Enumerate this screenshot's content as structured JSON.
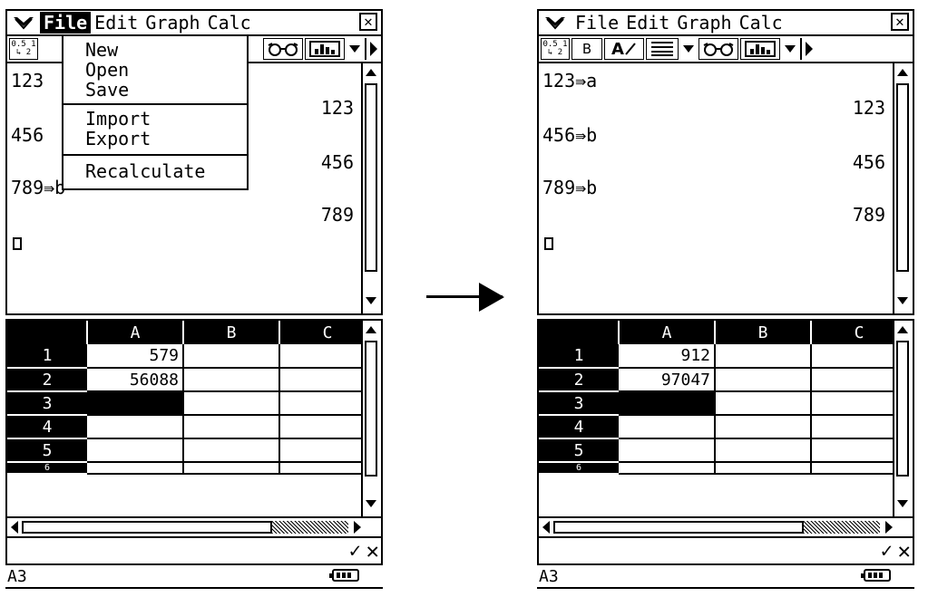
{
  "left": {
    "menu": [
      "File",
      "Edit",
      "Graph",
      "Calc"
    ],
    "active_menu": "File",
    "close_label": "✕",
    "toolbar": {
      "frac_top": "0.5 1",
      "frac_bot": "↳ 2"
    },
    "dropdown": [
      "New",
      "Open",
      "Save",
      "Import",
      "Export",
      "Recalculate"
    ],
    "main": {
      "partial_inputs": [
        "123",
        "456",
        "789⇛b"
      ],
      "outputs": [
        "123",
        "456",
        "789"
      ]
    },
    "sheet": {
      "columns": [
        "A",
        "B",
        "C"
      ],
      "rows": [
        {
          "num": "1",
          "a": "579"
        },
        {
          "num": "2",
          "a": "56088"
        },
        {
          "num": "3",
          "a": ""
        },
        {
          "num": "4",
          "a": ""
        },
        {
          "num": "5",
          "a": ""
        },
        {
          "num": "6",
          "a": ""
        }
      ]
    },
    "cell_ref": "A3"
  },
  "right": {
    "menu": [
      "File",
      "Edit",
      "Graph",
      "Calc"
    ],
    "close_label": "✕",
    "toolbar": {
      "frac_top": "0.5 1",
      "frac_bot": "↳ 2",
      "b_label": "B",
      "a_label": "A"
    },
    "main": {
      "inputs": [
        "123⇛a",
        "456⇛b",
        "789⇛b"
      ],
      "outputs": [
        "123",
        "456",
        "789"
      ]
    },
    "sheet": {
      "columns": [
        "A",
        "B",
        "C"
      ],
      "rows": [
        {
          "num": "1",
          "a": "912"
        },
        {
          "num": "2",
          "a": "97047"
        },
        {
          "num": "3",
          "a": ""
        },
        {
          "num": "4",
          "a": ""
        },
        {
          "num": "5",
          "a": ""
        },
        {
          "num": "6",
          "a": ""
        }
      ]
    },
    "cell_ref": "A3"
  },
  "icons": [
    "menu-chevron-icon",
    "close-icon",
    "fraction-icon",
    "bold-icon",
    "font-edit-icon",
    "align-icon",
    "dropdown-arrow-icon",
    "view-glasses-icon",
    "graph-icon",
    "right-arrow-icon",
    "scroll-up-icon",
    "scroll-down-icon",
    "scroll-left-icon",
    "scroll-right-icon",
    "check-icon",
    "cancel-icon",
    "battery-icon",
    "transition-arrow-icon"
  ]
}
